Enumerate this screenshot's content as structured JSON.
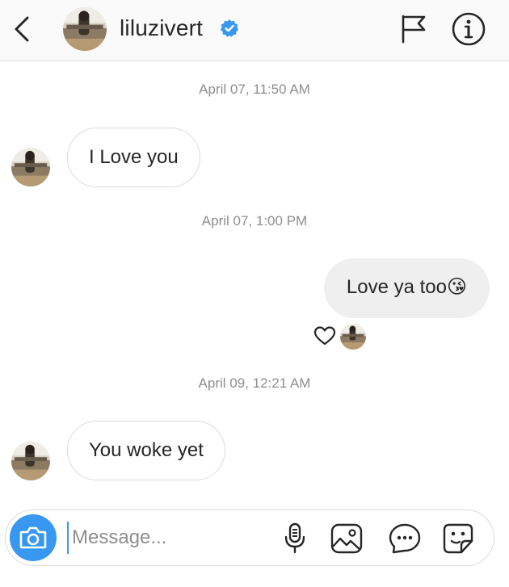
{
  "header": {
    "username": "liluzivert"
  },
  "messages": [
    {
      "timestamp": "April 07, 11:50 AM",
      "text": "I Love you",
      "direction": "incoming"
    },
    {
      "timestamp": "April 07, 1:00 PM",
      "text": "Love ya too",
      "emoji": "😘",
      "direction": "outgoing",
      "reaction": "heart"
    },
    {
      "timestamp": "April 09, 12:21 AM",
      "text": "You woke yet",
      "direction": "incoming"
    }
  ],
  "composer": {
    "placeholder": "Message..."
  },
  "icons": {
    "back": "chevron-left-icon",
    "verified": "verified-badge-icon",
    "flag": "flag-icon",
    "info": "info-icon",
    "camera": "camera-icon",
    "mic": "microphone-icon",
    "gallery": "image-icon",
    "more": "more-icon",
    "sticker": "sticker-icon"
  },
  "colors": {
    "accent": "#3897f0",
    "incoming_bubble_border": "#dbdbdb",
    "outgoing_bubble": "#efefef",
    "timestamp": "#8e8e8e",
    "heart": "#262626"
  }
}
